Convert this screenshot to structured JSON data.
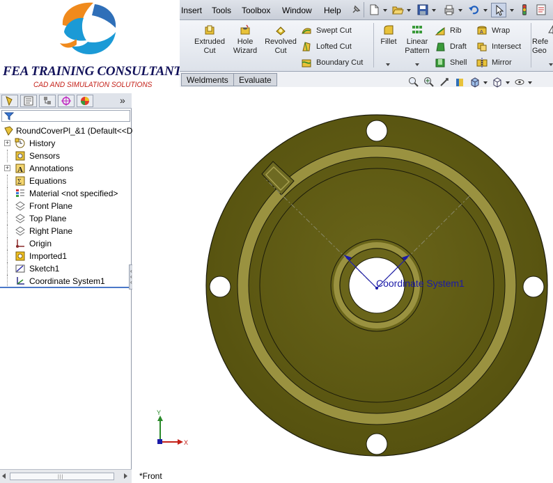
{
  "logo": {
    "company": "FEA TRAINING  CONSULTANTS INC.",
    "tagline": "CAD AND SIMULATION SOLUTIONS"
  },
  "menubar": {
    "items": [
      "Insert",
      "Tools",
      "Toolbox",
      "Window",
      "Help"
    ]
  },
  "ribbon": {
    "extruded_cut": [
      "Extruded",
      "Cut"
    ],
    "hole_wizard": [
      "Hole",
      "Wizard"
    ],
    "revolved_cut": [
      "Revolved",
      "Cut"
    ],
    "swept_cut": "Swept Cut",
    "lofted_cut": "Lofted Cut",
    "boundary_cut": "Boundary Cut",
    "fillet": "Fillet",
    "linear_pattern": [
      "Linear",
      "Pattern"
    ],
    "rib": "Rib",
    "draft": "Draft",
    "shell": "Shell",
    "wrap": "Wrap",
    "intersect": "Intersect",
    "mirror": "Mirror",
    "reference_geometry": [
      "Refe",
      "Geo"
    ]
  },
  "tabs": [
    "Weldments",
    "Evaluate"
  ],
  "feature_tree": {
    "root": "RoundCoverPl_&1  (Default<<D",
    "items": [
      {
        "label": "History",
        "expandable": true,
        "icon": "history-icon"
      },
      {
        "label": "Sensors",
        "expandable": false,
        "icon": "sensors-icon"
      },
      {
        "label": "Annotations",
        "expandable": true,
        "icon": "annotations-icon"
      },
      {
        "label": "Equations",
        "expandable": false,
        "icon": "equations-icon"
      },
      {
        "label": "Material <not specified>",
        "expandable": false,
        "icon": "material-icon"
      },
      {
        "label": "Front Plane",
        "expandable": false,
        "icon": "plane-icon"
      },
      {
        "label": "Top Plane",
        "expandable": false,
        "icon": "plane-icon"
      },
      {
        "label": "Right Plane",
        "expandable": false,
        "icon": "plane-icon"
      },
      {
        "label": "Origin",
        "expandable": false,
        "icon": "origin-icon"
      },
      {
        "label": "Imported1",
        "expandable": false,
        "icon": "imported-feature-icon"
      },
      {
        "label": "Sketch1",
        "expandable": false,
        "icon": "sketch-icon"
      },
      {
        "label": "Coordinate System1",
        "expandable": false,
        "icon": "coordinate-system-icon"
      }
    ]
  },
  "graphics": {
    "coordinate_system_label": "Coordinate System1",
    "view_name": "*Front",
    "triad_x": "X",
    "triad_y": "Y",
    "part_color": "#5e5a14"
  },
  "colors": {
    "part_face": "#5e5a14",
    "part_rim": "#8b8434",
    "selection_blue": "#1a1aa8",
    "logo_navy": "#12125a",
    "logo_red": "#c42018"
  }
}
